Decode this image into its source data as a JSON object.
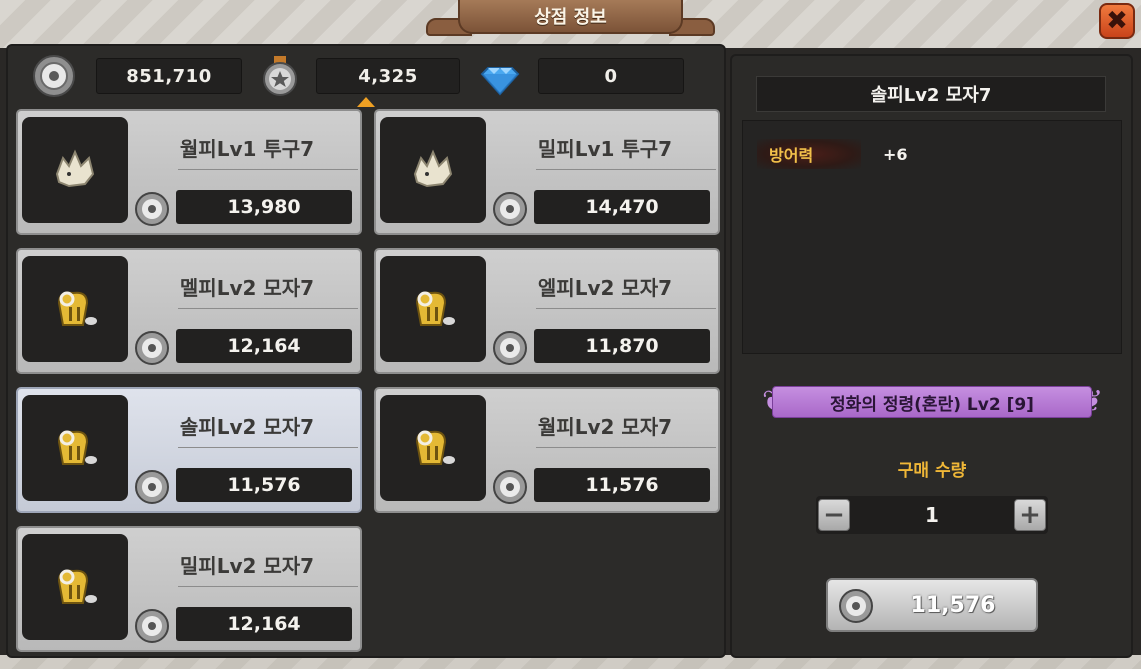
{
  "window": {
    "title": "상점 정보",
    "close_label": "✖"
  },
  "currency": {
    "gold": {
      "icon": "silver-coin-icon",
      "value": "851,710"
    },
    "medal": {
      "icon": "star-medal-icon",
      "value": "4,325"
    },
    "gem": {
      "icon": "diamond-icon",
      "value": "0"
    }
  },
  "items": [
    {
      "name": "월피Lv1 투구7",
      "price": "13,980",
      "icon": "wolf-helmet-icon"
    },
    {
      "name": "밀피Lv1 투구7",
      "price": "14,470",
      "icon": "wolf-helmet-icon"
    },
    {
      "name": "멜피Lv2 모자7",
      "price": "12,164",
      "icon": "ram-hat-icon"
    },
    {
      "name": "엘피Lv2 모자7",
      "price": "11,870",
      "icon": "ram-hat-icon"
    },
    {
      "name": "솔피Lv2 모자7",
      "price": "11,576",
      "icon": "ram-hat-icon",
      "selected": true
    },
    {
      "name": "월피Lv2 모자7",
      "price": "11,576",
      "icon": "ram-hat-icon"
    },
    {
      "name": "밀피Lv2 모자7",
      "price": "12,164",
      "icon": "ram-hat-icon"
    }
  ],
  "detail": {
    "title": "솔피Lv2 모자7",
    "stat_label": "방어력",
    "stat_value": "+6",
    "requirement": "정화의 정령(혼란) Lv2 [9]",
    "quantity_label": "구매 수량",
    "quantity": "1",
    "minus_label": "−",
    "plus_label": "+",
    "buy_price": "11,576"
  },
  "colors": {
    "accent_orange": "#f0a123",
    "stat_label_yellow": "#f2c14a",
    "requirement_purple": "#b77ad6",
    "selected_card": "#d2d7e2"
  }
}
